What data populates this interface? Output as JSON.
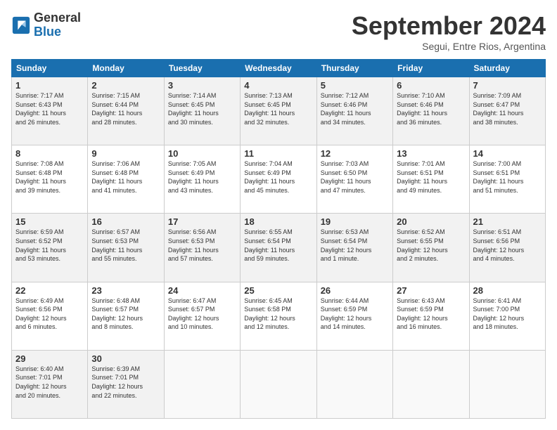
{
  "logo": {
    "line1": "General",
    "line2": "Blue"
  },
  "title": "September 2024",
  "subtitle": "Segui, Entre Rios, Argentina",
  "days_header": [
    "Sunday",
    "Monday",
    "Tuesday",
    "Wednesday",
    "Thursday",
    "Friday",
    "Saturday"
  ],
  "weeks": [
    [
      {
        "day": "1",
        "info": "Sunrise: 7:17 AM\nSunset: 6:43 PM\nDaylight: 11 hours\nand 26 minutes."
      },
      {
        "day": "2",
        "info": "Sunrise: 7:15 AM\nSunset: 6:44 PM\nDaylight: 11 hours\nand 28 minutes."
      },
      {
        "day": "3",
        "info": "Sunrise: 7:14 AM\nSunset: 6:45 PM\nDaylight: 11 hours\nand 30 minutes."
      },
      {
        "day": "4",
        "info": "Sunrise: 7:13 AM\nSunset: 6:45 PM\nDaylight: 11 hours\nand 32 minutes."
      },
      {
        "day": "5",
        "info": "Sunrise: 7:12 AM\nSunset: 6:46 PM\nDaylight: 11 hours\nand 34 minutes."
      },
      {
        "day": "6",
        "info": "Sunrise: 7:10 AM\nSunset: 6:46 PM\nDaylight: 11 hours\nand 36 minutes."
      },
      {
        "day": "7",
        "info": "Sunrise: 7:09 AM\nSunset: 6:47 PM\nDaylight: 11 hours\nand 38 minutes."
      }
    ],
    [
      {
        "day": "8",
        "info": "Sunrise: 7:08 AM\nSunset: 6:48 PM\nDaylight: 11 hours\nand 39 minutes."
      },
      {
        "day": "9",
        "info": "Sunrise: 7:06 AM\nSunset: 6:48 PM\nDaylight: 11 hours\nand 41 minutes."
      },
      {
        "day": "10",
        "info": "Sunrise: 7:05 AM\nSunset: 6:49 PM\nDaylight: 11 hours\nand 43 minutes."
      },
      {
        "day": "11",
        "info": "Sunrise: 7:04 AM\nSunset: 6:49 PM\nDaylight: 11 hours\nand 45 minutes."
      },
      {
        "day": "12",
        "info": "Sunrise: 7:03 AM\nSunset: 6:50 PM\nDaylight: 11 hours\nand 47 minutes."
      },
      {
        "day": "13",
        "info": "Sunrise: 7:01 AM\nSunset: 6:51 PM\nDaylight: 11 hours\nand 49 minutes."
      },
      {
        "day": "14",
        "info": "Sunrise: 7:00 AM\nSunset: 6:51 PM\nDaylight: 11 hours\nand 51 minutes."
      }
    ],
    [
      {
        "day": "15",
        "info": "Sunrise: 6:59 AM\nSunset: 6:52 PM\nDaylight: 11 hours\nand 53 minutes."
      },
      {
        "day": "16",
        "info": "Sunrise: 6:57 AM\nSunset: 6:53 PM\nDaylight: 11 hours\nand 55 minutes."
      },
      {
        "day": "17",
        "info": "Sunrise: 6:56 AM\nSunset: 6:53 PM\nDaylight: 11 hours\nand 57 minutes."
      },
      {
        "day": "18",
        "info": "Sunrise: 6:55 AM\nSunset: 6:54 PM\nDaylight: 11 hours\nand 59 minutes."
      },
      {
        "day": "19",
        "info": "Sunrise: 6:53 AM\nSunset: 6:54 PM\nDaylight: 12 hours\nand 1 minute."
      },
      {
        "day": "20",
        "info": "Sunrise: 6:52 AM\nSunset: 6:55 PM\nDaylight: 12 hours\nand 2 minutes."
      },
      {
        "day": "21",
        "info": "Sunrise: 6:51 AM\nSunset: 6:56 PM\nDaylight: 12 hours\nand 4 minutes."
      }
    ],
    [
      {
        "day": "22",
        "info": "Sunrise: 6:49 AM\nSunset: 6:56 PM\nDaylight: 12 hours\nand 6 minutes."
      },
      {
        "day": "23",
        "info": "Sunrise: 6:48 AM\nSunset: 6:57 PM\nDaylight: 12 hours\nand 8 minutes."
      },
      {
        "day": "24",
        "info": "Sunrise: 6:47 AM\nSunset: 6:57 PM\nDaylight: 12 hours\nand 10 minutes."
      },
      {
        "day": "25",
        "info": "Sunrise: 6:45 AM\nSunset: 6:58 PM\nDaylight: 12 hours\nand 12 minutes."
      },
      {
        "day": "26",
        "info": "Sunrise: 6:44 AM\nSunset: 6:59 PM\nDaylight: 12 hours\nand 14 minutes."
      },
      {
        "day": "27",
        "info": "Sunrise: 6:43 AM\nSunset: 6:59 PM\nDaylight: 12 hours\nand 16 minutes."
      },
      {
        "day": "28",
        "info": "Sunrise: 6:41 AM\nSunset: 7:00 PM\nDaylight: 12 hours\nand 18 minutes."
      }
    ],
    [
      {
        "day": "29",
        "info": "Sunrise: 6:40 AM\nSunset: 7:01 PM\nDaylight: 12 hours\nand 20 minutes."
      },
      {
        "day": "30",
        "info": "Sunrise: 6:39 AM\nSunset: 7:01 PM\nDaylight: 12 hours\nand 22 minutes."
      },
      {
        "day": "",
        "info": ""
      },
      {
        "day": "",
        "info": ""
      },
      {
        "day": "",
        "info": ""
      },
      {
        "day": "",
        "info": ""
      },
      {
        "day": "",
        "info": ""
      }
    ]
  ]
}
